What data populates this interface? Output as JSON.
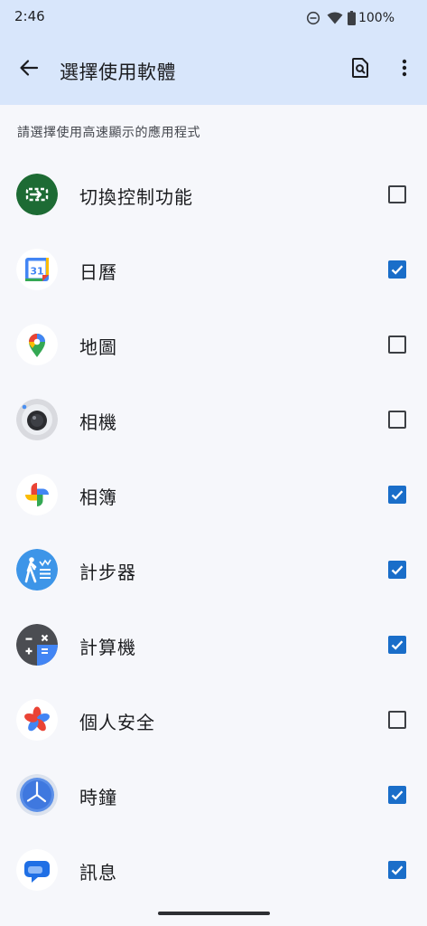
{
  "status_bar": {
    "time": "2:46",
    "battery": "100%",
    "icons": [
      "do-not-disturb-icon",
      "wifi-icon",
      "battery-icon"
    ]
  },
  "app_bar": {
    "title": "選擇使用軟體",
    "back_icon": "arrow-back-icon",
    "search_icon": "search-page-icon",
    "more_icon": "more-vert-icon"
  },
  "subtitle": "請選擇使用高速顯示的應用程式",
  "colors": {
    "header_bg": "#d8e6fb",
    "page_bg": "#f6f7fb",
    "checkbox_checked": "#1a6ec9"
  },
  "apps": [
    {
      "label": "切換控制功能",
      "icon": "switch-access-icon",
      "checked": false
    },
    {
      "label": "日曆",
      "icon": "calendar-icon",
      "checked": true
    },
    {
      "label": "地圖",
      "icon": "maps-icon",
      "checked": false
    },
    {
      "label": "相機",
      "icon": "camera-icon",
      "checked": false
    },
    {
      "label": "相簿",
      "icon": "photos-icon",
      "checked": true
    },
    {
      "label": "計步器",
      "icon": "pedometer-icon",
      "checked": true
    },
    {
      "label": "計算機",
      "icon": "calculator-icon",
      "checked": true
    },
    {
      "label": "個人安全",
      "icon": "personal-safety-icon",
      "checked": false
    },
    {
      "label": "時鐘",
      "icon": "clock-icon",
      "checked": true
    },
    {
      "label": "訊息",
      "icon": "messages-icon",
      "checked": true
    }
  ]
}
